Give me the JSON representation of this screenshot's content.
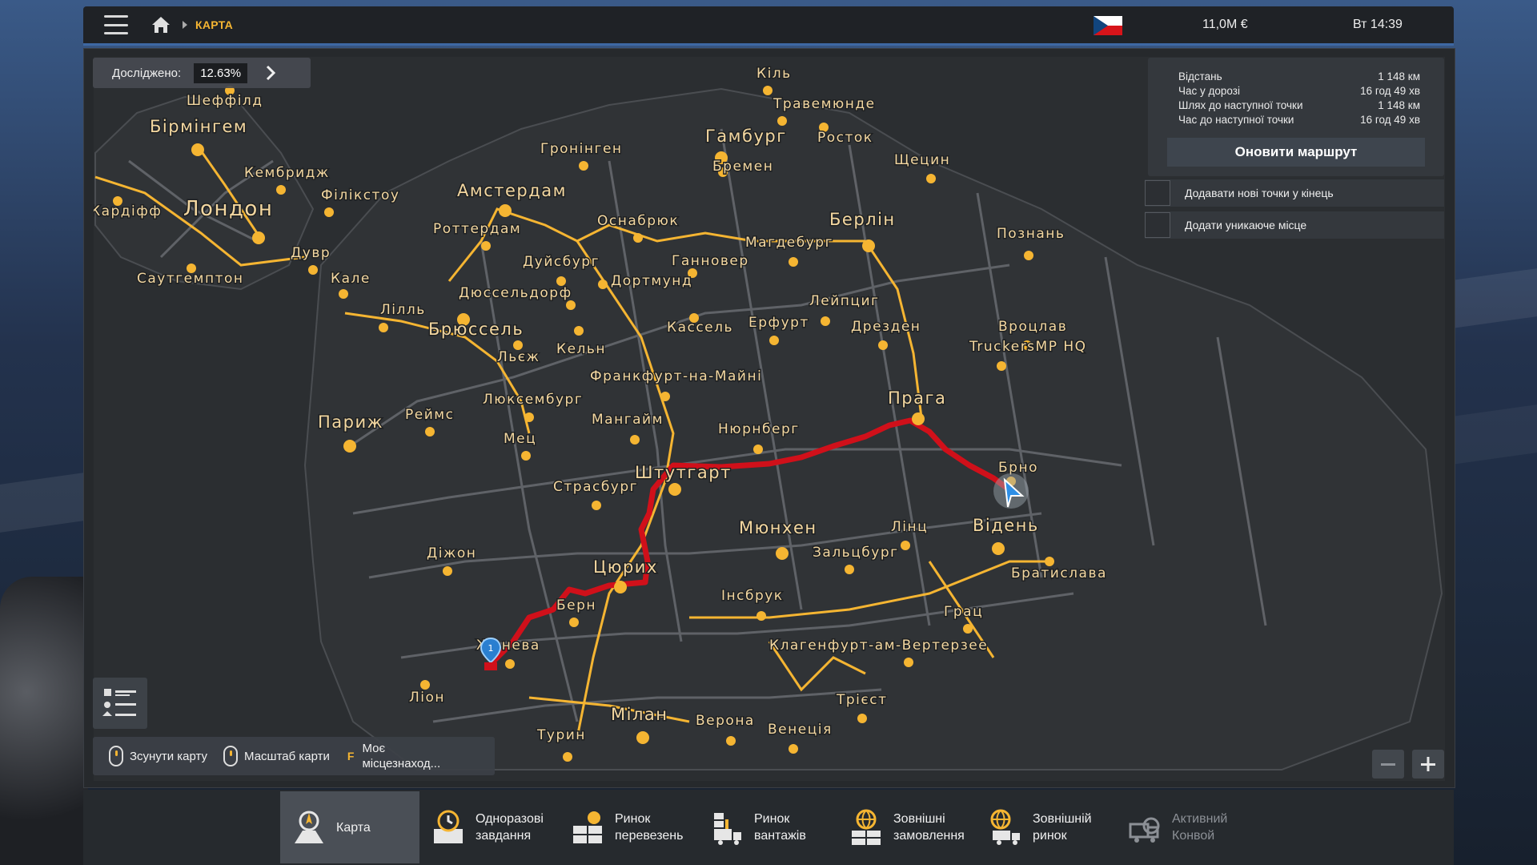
{
  "topbar": {
    "breadcrumb": "КАРТА",
    "money": "11,0M €",
    "clock": "Вт 14:39"
  },
  "explored": {
    "label": "Досліджено:",
    "value": "12.63%"
  },
  "route_info": {
    "rows": [
      {
        "label": "Відстань",
        "value": "1 148 км"
      },
      {
        "label": "Час у дорозі",
        "value": "16 год 49 хв"
      },
      {
        "label": "Шлях до наступної точки",
        "value": "1 148 км"
      },
      {
        "label": "Час до наступної точки",
        "value": "16 год 49 хв"
      }
    ],
    "update_button": "Оновити маршрут"
  },
  "options": [
    {
      "label": "Додавати нові точки у кінець"
    },
    {
      "label": "Додати уникаюче місце"
    }
  ],
  "controls": {
    "move_map": "Зсунути карту",
    "zoom_map": "Масштаб карти",
    "key": "F",
    "my_location": "Моє\nмісцезнаход..."
  },
  "map": {
    "waypoint_number": "1",
    "cities": [
      {
        "name": "Кіль"
      },
      {
        "name": "Травемюнде"
      },
      {
        "name": "Шеффілд"
      },
      {
        "name": "Бірмінгем"
      },
      {
        "name": "Гамбург"
      },
      {
        "name": "Росток"
      },
      {
        "name": "Гронінген"
      },
      {
        "name": "Бремен"
      },
      {
        "name": "Щецин"
      },
      {
        "name": "Кембридж"
      },
      {
        "name": "Філікстоу"
      },
      {
        "name": "Амстердам"
      },
      {
        "name": "Кардіфф"
      },
      {
        "name": "Лондон"
      },
      {
        "name": "Роттердам"
      },
      {
        "name": "Оснабрюк"
      },
      {
        "name": "Берлін"
      },
      {
        "name": "Магдебург"
      },
      {
        "name": "Познань"
      },
      {
        "name": "Дувр"
      },
      {
        "name": "Дуйсбург"
      },
      {
        "name": "Ганновер"
      },
      {
        "name": "Саутгемптон"
      },
      {
        "name": "Кале"
      },
      {
        "name": "Дюссельдорф"
      },
      {
        "name": "Дортмунд"
      },
      {
        "name": "Лілль"
      },
      {
        "name": "Лейпциг"
      },
      {
        "name": "Брюссель"
      },
      {
        "name": "Кассель"
      },
      {
        "name": "Ерфурт"
      },
      {
        "name": "Дрезден"
      },
      {
        "name": "Вроцлав"
      },
      {
        "name": "Кельн"
      },
      {
        "name": "TruckersMP HQ"
      },
      {
        "name": "Льєж"
      },
      {
        "name": "Франкфурт-на-Майні"
      },
      {
        "name": "Люксембург"
      },
      {
        "name": "Прага"
      },
      {
        "name": "Реймс"
      },
      {
        "name": "Париж"
      },
      {
        "name": "Мангайм"
      },
      {
        "name": "Нюрнберг"
      },
      {
        "name": "Мец"
      },
      {
        "name": "Брно"
      },
      {
        "name": "Штутгарт"
      },
      {
        "name": "Страсбург"
      },
      {
        "name": "Лінц"
      },
      {
        "name": "Відень"
      },
      {
        "name": "Мюнхен"
      },
      {
        "name": "Зальцбург"
      },
      {
        "name": "Діжон"
      },
      {
        "name": "Братислава"
      },
      {
        "name": "Цюрих"
      },
      {
        "name": "Інсбрук"
      },
      {
        "name": "Берн"
      },
      {
        "name": "Грац"
      },
      {
        "name": "Женева"
      },
      {
        "name": "Клагенфурт-ам-Вертерзее"
      },
      {
        "name": "Ліон"
      },
      {
        "name": "Трієст"
      },
      {
        "name": "Мілан"
      },
      {
        "name": "Верона"
      },
      {
        "name": "Венеція"
      },
      {
        "name": "Турин"
      }
    ]
  },
  "tabs": [
    {
      "label": "Карта",
      "active": true
    },
    {
      "label": "Одноразові\nзавдання"
    },
    {
      "label": "Ринок\nперевезень"
    },
    {
      "label": "Ринок\nвантажів"
    },
    {
      "label": "Зовнішні\nзамовлення"
    },
    {
      "label": "Зовнішній\nринок"
    },
    {
      "label": "Активний\nКонвой",
      "disabled": true
    }
  ],
  "colors": {
    "accent": "#f5b532",
    "route": "#d0101a",
    "road": "#6b6e72",
    "active_tab": "#4a4f56"
  }
}
